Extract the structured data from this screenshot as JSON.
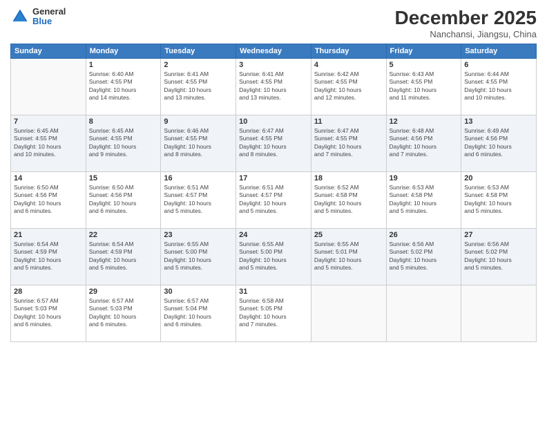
{
  "logo": {
    "general": "General",
    "blue": "Blue"
  },
  "title": "December 2025",
  "location": "Nanchansi, Jiangsu, China",
  "weekdays": [
    "Sunday",
    "Monday",
    "Tuesday",
    "Wednesday",
    "Thursday",
    "Friday",
    "Saturday"
  ],
  "weeks": [
    [
      {
        "day": "",
        "info": ""
      },
      {
        "day": "1",
        "info": "Sunrise: 6:40 AM\nSunset: 4:55 PM\nDaylight: 10 hours\nand 14 minutes."
      },
      {
        "day": "2",
        "info": "Sunrise: 6:41 AM\nSunset: 4:55 PM\nDaylight: 10 hours\nand 13 minutes."
      },
      {
        "day": "3",
        "info": "Sunrise: 6:41 AM\nSunset: 4:55 PM\nDaylight: 10 hours\nand 13 minutes."
      },
      {
        "day": "4",
        "info": "Sunrise: 6:42 AM\nSunset: 4:55 PM\nDaylight: 10 hours\nand 12 minutes."
      },
      {
        "day": "5",
        "info": "Sunrise: 6:43 AM\nSunset: 4:55 PM\nDaylight: 10 hours\nand 11 minutes."
      },
      {
        "day": "6",
        "info": "Sunrise: 6:44 AM\nSunset: 4:55 PM\nDaylight: 10 hours\nand 10 minutes."
      }
    ],
    [
      {
        "day": "7",
        "info": "Sunrise: 6:45 AM\nSunset: 4:55 PM\nDaylight: 10 hours\nand 10 minutes."
      },
      {
        "day": "8",
        "info": "Sunrise: 6:45 AM\nSunset: 4:55 PM\nDaylight: 10 hours\nand 9 minutes."
      },
      {
        "day": "9",
        "info": "Sunrise: 6:46 AM\nSunset: 4:55 PM\nDaylight: 10 hours\nand 8 minutes."
      },
      {
        "day": "10",
        "info": "Sunrise: 6:47 AM\nSunset: 4:55 PM\nDaylight: 10 hours\nand 8 minutes."
      },
      {
        "day": "11",
        "info": "Sunrise: 6:47 AM\nSunset: 4:55 PM\nDaylight: 10 hours\nand 7 minutes."
      },
      {
        "day": "12",
        "info": "Sunrise: 6:48 AM\nSunset: 4:56 PM\nDaylight: 10 hours\nand 7 minutes."
      },
      {
        "day": "13",
        "info": "Sunrise: 6:49 AM\nSunset: 4:56 PM\nDaylight: 10 hours\nand 6 minutes."
      }
    ],
    [
      {
        "day": "14",
        "info": "Sunrise: 6:50 AM\nSunset: 4:56 PM\nDaylight: 10 hours\nand 6 minutes."
      },
      {
        "day": "15",
        "info": "Sunrise: 6:50 AM\nSunset: 4:56 PM\nDaylight: 10 hours\nand 6 minutes."
      },
      {
        "day": "16",
        "info": "Sunrise: 6:51 AM\nSunset: 4:57 PM\nDaylight: 10 hours\nand 5 minutes."
      },
      {
        "day": "17",
        "info": "Sunrise: 6:51 AM\nSunset: 4:57 PM\nDaylight: 10 hours\nand 5 minutes."
      },
      {
        "day": "18",
        "info": "Sunrise: 6:52 AM\nSunset: 4:58 PM\nDaylight: 10 hours\nand 5 minutes."
      },
      {
        "day": "19",
        "info": "Sunrise: 6:53 AM\nSunset: 4:58 PM\nDaylight: 10 hours\nand 5 minutes."
      },
      {
        "day": "20",
        "info": "Sunrise: 6:53 AM\nSunset: 4:58 PM\nDaylight: 10 hours\nand 5 minutes."
      }
    ],
    [
      {
        "day": "21",
        "info": "Sunrise: 6:54 AM\nSunset: 4:59 PM\nDaylight: 10 hours\nand 5 minutes."
      },
      {
        "day": "22",
        "info": "Sunrise: 6:54 AM\nSunset: 4:59 PM\nDaylight: 10 hours\nand 5 minutes."
      },
      {
        "day": "23",
        "info": "Sunrise: 6:55 AM\nSunset: 5:00 PM\nDaylight: 10 hours\nand 5 minutes."
      },
      {
        "day": "24",
        "info": "Sunrise: 6:55 AM\nSunset: 5:00 PM\nDaylight: 10 hours\nand 5 minutes."
      },
      {
        "day": "25",
        "info": "Sunrise: 6:55 AM\nSunset: 5:01 PM\nDaylight: 10 hours\nand 5 minutes."
      },
      {
        "day": "26",
        "info": "Sunrise: 6:56 AM\nSunset: 5:02 PM\nDaylight: 10 hours\nand 5 minutes."
      },
      {
        "day": "27",
        "info": "Sunrise: 6:56 AM\nSunset: 5:02 PM\nDaylight: 10 hours\nand 5 minutes."
      }
    ],
    [
      {
        "day": "28",
        "info": "Sunrise: 6:57 AM\nSunset: 5:03 PM\nDaylight: 10 hours\nand 6 minutes."
      },
      {
        "day": "29",
        "info": "Sunrise: 6:57 AM\nSunset: 5:03 PM\nDaylight: 10 hours\nand 6 minutes."
      },
      {
        "day": "30",
        "info": "Sunrise: 6:57 AM\nSunset: 5:04 PM\nDaylight: 10 hours\nand 6 minutes."
      },
      {
        "day": "31",
        "info": "Sunrise: 6:58 AM\nSunset: 5:05 PM\nDaylight: 10 hours\nand 7 minutes."
      },
      {
        "day": "",
        "info": ""
      },
      {
        "day": "",
        "info": ""
      },
      {
        "day": "",
        "info": ""
      }
    ]
  ]
}
